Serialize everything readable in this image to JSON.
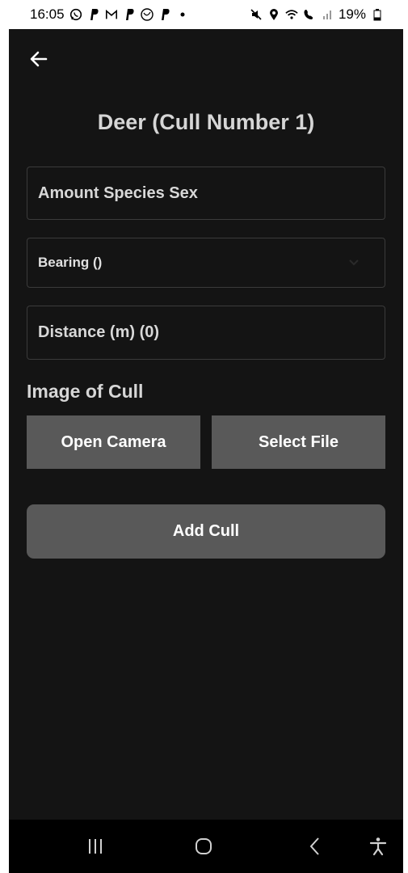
{
  "status_bar": {
    "time": "16:05",
    "battery": "19%",
    "left_icons": [
      "whatsapp-icon",
      "paypal-icon",
      "gmail-icon",
      "paypal-icon",
      "virgin-icon",
      "paypal-icon",
      "dot-icon"
    ],
    "right_icons": [
      "mute-icon",
      "location-icon",
      "wifi-icon",
      "wifi-calling-icon",
      "signal-icon",
      "battery-icon"
    ]
  },
  "header": {
    "back_icon": "arrow-left-icon",
    "title": "Deer (Cull Number 1)"
  },
  "form": {
    "amount_species_sex": {
      "placeholder": "Amount Species Sex",
      "value": ""
    },
    "bearing": {
      "value": "Bearing ()",
      "icon": "chevron-down-icon"
    },
    "distance": {
      "placeholder": "Distance (m) (0)",
      "value": ""
    }
  },
  "image_section": {
    "label": "Image of Cull",
    "open_camera_label": "Open Camera",
    "select_file_label": "Select File"
  },
  "actions": {
    "add_cull_label": "Add Cull"
  },
  "nav_bar": {
    "icons": [
      "recent-apps-icon",
      "home-icon",
      "back-icon",
      "accessibility-icon"
    ]
  },
  "colors": {
    "background": "#141414",
    "button": "#595959",
    "text": "#d6d6d6",
    "field_border": "#3b3b3b"
  }
}
